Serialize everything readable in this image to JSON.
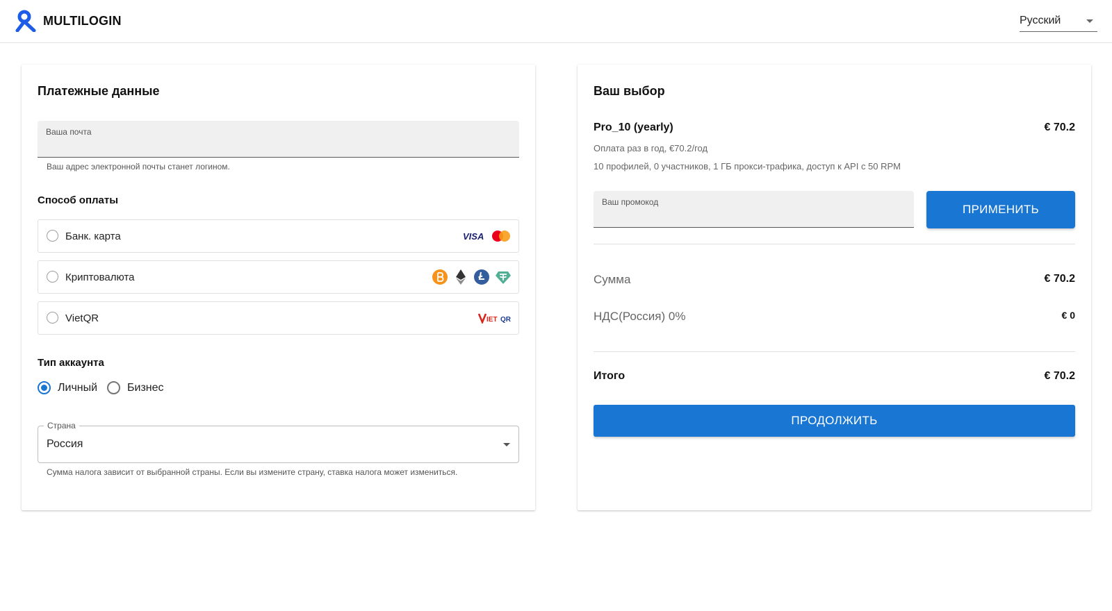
{
  "header": {
    "brand": "MULTILOGIN",
    "language": "Русский",
    "icons": {
      "logo": "multilogin-logo",
      "language_dropdown": "chevron-down-icon"
    }
  },
  "payment_details": {
    "title": "Платежные данные",
    "email": {
      "label": "Ваша почта",
      "value": "",
      "helper": "Ваш адрес электронной почты станет логином."
    },
    "payment_method": {
      "label": "Способ оплаты",
      "options": [
        {
          "label": "Банк. карта",
          "icons": [
            "visa-logo",
            "mastercard-logo"
          ],
          "visa_text": "VISA"
        },
        {
          "label": "Криптовалюта",
          "icons": [
            "bitcoin-icon",
            "ethereum-icon",
            "litecoin-icon",
            "tether-icon"
          ]
        },
        {
          "label": "VietQR",
          "icons": [
            "vietqr-logo"
          ]
        }
      ]
    },
    "account_type": {
      "label": "Тип аккаунта",
      "options": [
        {
          "label": "Личный",
          "selected": true
        },
        {
          "label": "Бизнес",
          "selected": false
        }
      ]
    },
    "country": {
      "label": "Страна",
      "value": "Россия",
      "helper": "Сумма налога зависит от выбранной страны. Если вы измените страну, ставка налога может измениться."
    }
  },
  "order": {
    "title": "Ваш выбор",
    "plan_name": "Pro_10 (yearly)",
    "plan_price": "€ 70.2",
    "billing_note": "Оплата раз в год, €70.2/год",
    "features": "10 профилей, 0 участников, 1 ГБ прокси-трафика, доступ к API с 50 RPM",
    "promo": {
      "label": "Ваш промокод",
      "value": "",
      "apply_label": "ПРИМЕНИТЬ"
    },
    "sum_label": "Сумма",
    "sum_value": "€ 70.2",
    "vat_label": "НДС(Россия) 0%",
    "vat_value": "€ 0",
    "total_label": "Итого",
    "total_value": "€ 70.2",
    "continue_label": "ПРОДОЛЖИТЬ"
  },
  "colors": {
    "primary": "#1976d2",
    "field_bg": "#f0f0f0",
    "border": "#e0e0e0",
    "muted_text": "#666666"
  }
}
